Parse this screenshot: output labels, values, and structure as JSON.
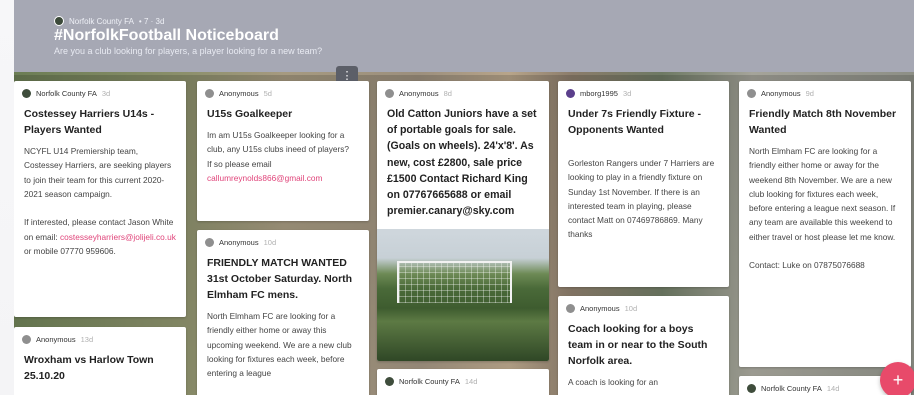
{
  "header": {
    "org": "Norfolk County FA",
    "meta": "• 7 · 3d",
    "title": "#NorfolkFootball Noticeboard",
    "subtitle": "Are you a club looking for players, a player looking for a new team?"
  },
  "more_button": {
    "icon": "⋮"
  },
  "fab": {
    "icon": "+"
  },
  "cards": [
    {
      "author": "Norfolk County FA",
      "age": "3d",
      "title": "Costessey Harriers U14s - Players Wanted",
      "body": "NCYFL U14 Premiership team, Costessey Harriers, are seeking players to join their team for this current 2020-2021 season campaign.\n\nIf interested, please contact Jason White on email: ",
      "link": "costesseyharriers@jolijeli.co.uk",
      "body_after": " or mobile 07770 959606."
    },
    {
      "author": "Anonymous",
      "age": "5d",
      "title": "U15s Goalkeeper",
      "body": "Im am U15s Goalkeeper looking for a club, any U15s clubs ineed of players?\nIf so please email\n",
      "link": "callumreynolds866@gmail.com"
    },
    {
      "author": "Anonymous",
      "age": "8d",
      "title": "Old Catton Juniors have a set of portable goals for sale. (Goals on wheels). 24'x'8'. As new, cost £2800, sale price £1500 Contact Richard King on 07767665688 or email premier.canary@sky.com"
    },
    {
      "author": "mborg1995",
      "age": "3d",
      "title": "Under 7s Friendly Fixture - Opponents Wanted",
      "body": "Gorleston Rangers under 7 Harriers are looking to play in a friendly fixture on Sunday 1st November. If there is an interested team in playing, please contact Matt on 07469786869. Many thanks"
    },
    {
      "author": "Anonymous",
      "age": "9d",
      "title": "Friendly Match 8th November Wanted",
      "body": "North Elmham FC are looking for a friendly either home or away for the weekend 8th November. We are a new club looking for fixtures each week, before entering a league next season. If any team are available this weekend to either travel or host please let me know.\n\nContact: Luke on 07875076688"
    },
    {
      "author": "Anonymous",
      "age": "10d",
      "title": "FRIENDLY MATCH WANTED 31st October Saturday. North Elmham FC mens.",
      "body": "North Elmham FC are looking for a friendly either home or away this upcoming weekend. We are a new club looking for fixtures each week, before entering a league"
    },
    {
      "author": "Anonymous",
      "age": "13d",
      "title": "Wroxham vs Harlow Town 25.10.20"
    },
    {
      "author": "Anonymous",
      "age": "10d",
      "title": "Coach looking for a boys team in or near to the South Norfolk area.",
      "body": "A coach is looking for an"
    },
    {
      "author": "Norfolk County FA",
      "age": "14d"
    },
    {
      "author": "Norfolk County FA",
      "age": "14d"
    }
  ],
  "colors": {
    "header_bg": "#a6a8b4",
    "link": "#e0447a",
    "fab": "#e84a6a"
  }
}
